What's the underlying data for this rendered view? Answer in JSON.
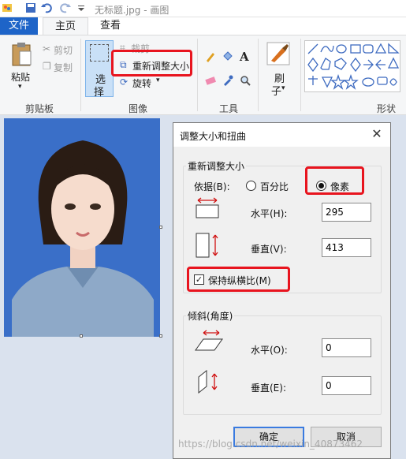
{
  "window": {
    "title": "无标题.jpg - 画图"
  },
  "tabs": {
    "file": "文件",
    "home": "主页",
    "view": "查看"
  },
  "ribbon": {
    "clipboard": {
      "paste": "粘贴",
      "cut": "剪切",
      "copy": "复制",
      "group_label": "剪贴板"
    },
    "image": {
      "select_line1": "选",
      "select_line2": "择",
      "crop": "裁剪",
      "resize": "重新调整大小",
      "rotate": "旋转",
      "group_label": "图像"
    },
    "tools": {
      "group_label": "工具"
    },
    "brushes": {
      "line1": "刷",
      "line2": "子"
    },
    "shapes": {
      "group_label": "形状"
    }
  },
  "dialog": {
    "title": "调整大小和扭曲",
    "resize_section": {
      "legend": "重新调整大小",
      "by_label": "依据(B):",
      "percent_option": "百分比",
      "pixels_option": "像素",
      "selected": "pixels",
      "horizontal_label": "水平(H):",
      "horizontal_value": "295",
      "vertical_label": "垂直(V):",
      "vertical_value": "413",
      "keep_ratio_label": "保持纵横比(M)",
      "keep_ratio_checked": true
    },
    "skew_section": {
      "legend": "倾斜(角度)",
      "horizontal_label": "水平(O):",
      "horizontal_value": "0",
      "vertical_label": "垂直(E):",
      "vertical_value": "0"
    },
    "ok_label": "确定",
    "cancel_label": "取消"
  },
  "watermark": "https://blog.csdn.net/weixin_40873462",
  "colors": {
    "accent": "#1e64c8",
    "highlight_red": "#e8141e",
    "photo_bg": "#3a6fc8"
  }
}
